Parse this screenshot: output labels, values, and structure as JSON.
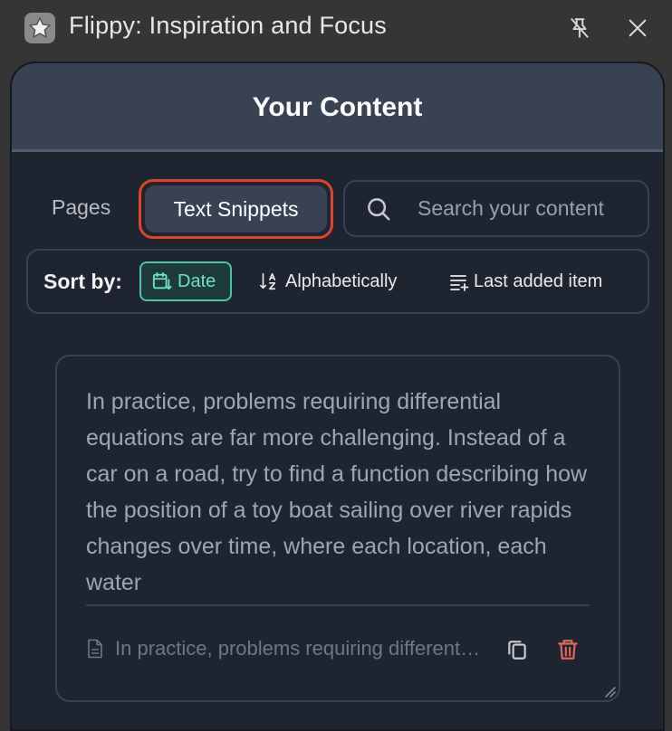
{
  "window": {
    "title": "Flippy: Inspiration and Focus",
    "app_icon": "star-icon",
    "pin_icon": "pin-off-icon",
    "close_icon": "close-icon"
  },
  "panel": {
    "title": "Your Content"
  },
  "tabs": [
    {
      "label": "Pages",
      "active": false
    },
    {
      "label": "Text Snippets",
      "active": true
    }
  ],
  "search": {
    "placeholder": "Search your content",
    "value": ""
  },
  "sort": {
    "label": "Sort by:",
    "options": [
      {
        "label": "Date",
        "icon": "calendar-sort-icon",
        "active": true
      },
      {
        "label": "Alphabetically",
        "icon": "sort-az-icon",
        "active": false
      },
      {
        "label": "Last added item",
        "icon": "list-add-icon",
        "active": false
      }
    ]
  },
  "snippet": {
    "text": "In practice, problems requiring differential equations are far more challenging. Instead of a car on a road, try to find a function describing how the position of a toy boat sailing over river rapids changes over time, where each location, each water",
    "source": "In practice, problems requiring differential equations are far more challenging.",
    "source_icon": "document-icon",
    "copy_icon": "copy-icon",
    "delete_icon": "trash-icon"
  },
  "colors": {
    "accent": "#4ec3aa",
    "highlight": "#e0432b",
    "delete": "#e0685a",
    "panel_bg": "#1f2530",
    "header_bg": "#384253"
  }
}
